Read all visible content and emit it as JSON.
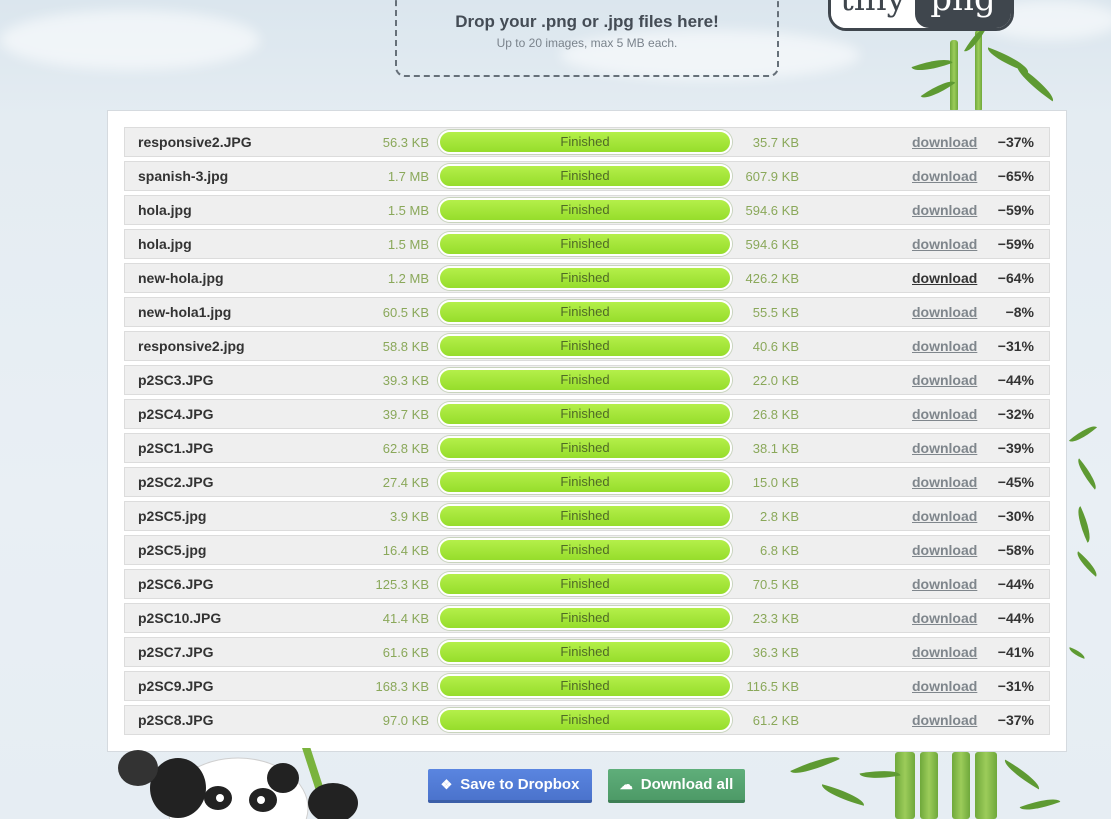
{
  "dropzone": {
    "title": "Drop your .png or .jpg files here!",
    "subtitle": "Up to 20 images, max 5 MB each."
  },
  "logo": {
    "left": "tiny",
    "right": "png"
  },
  "rows": [
    {
      "name": "responsive2.JPG",
      "size": "56.3 KB",
      "status": "Finished",
      "new_size": "35.7 KB",
      "link": "download",
      "saving": "−37%"
    },
    {
      "name": "spanish-3.jpg",
      "size": "1.7 MB",
      "status": "Finished",
      "new_size": "607.9 KB",
      "link": "download",
      "saving": "−65%"
    },
    {
      "name": "hola.jpg",
      "size": "1.5 MB",
      "status": "Finished",
      "new_size": "594.6 KB",
      "link": "download",
      "saving": "−59%"
    },
    {
      "name": "hola.jpg",
      "size": "1.5 MB",
      "status": "Finished",
      "new_size": "594.6 KB",
      "link": "download",
      "saving": "−59%"
    },
    {
      "name": "new-hola.jpg",
      "size": "1.2 MB",
      "status": "Finished",
      "new_size": "426.2 KB",
      "link": "download",
      "saving": "−64%"
    },
    {
      "name": "new-hola1.jpg",
      "size": "60.5 KB",
      "status": "Finished",
      "new_size": "55.5 KB",
      "link": "download",
      "saving": "−8%"
    },
    {
      "name": "responsive2.jpg",
      "size": "58.8 KB",
      "status": "Finished",
      "new_size": "40.6 KB",
      "link": "download",
      "saving": "−31%"
    },
    {
      "name": "p2SC3.JPG",
      "size": "39.3 KB",
      "status": "Finished",
      "new_size": "22.0 KB",
      "link": "download",
      "saving": "−44%"
    },
    {
      "name": "p2SC4.JPG",
      "size": "39.7 KB",
      "status": "Finished",
      "new_size": "26.8 KB",
      "link": "download",
      "saving": "−32%"
    },
    {
      "name": "p2SC1.JPG",
      "size": "62.8 KB",
      "status": "Finished",
      "new_size": "38.1 KB",
      "link": "download",
      "saving": "−39%"
    },
    {
      "name": "p2SC2.JPG",
      "size": "27.4 KB",
      "status": "Finished",
      "new_size": "15.0 KB",
      "link": "download",
      "saving": "−45%"
    },
    {
      "name": "p2SC5.jpg",
      "size": "3.9 KB",
      "status": "Finished",
      "new_size": "2.8 KB",
      "link": "download",
      "saving": "−30%"
    },
    {
      "name": "p2SC5.jpg",
      "size": "16.4 KB",
      "status": "Finished",
      "new_size": "6.8 KB",
      "link": "download",
      "saving": "−58%"
    },
    {
      "name": "p2SC6.JPG",
      "size": "125.3 KB",
      "status": "Finished",
      "new_size": "70.5 KB",
      "link": "download",
      "saving": "−44%"
    },
    {
      "name": "p2SC10.JPG",
      "size": "41.4 KB",
      "status": "Finished",
      "new_size": "23.3 KB",
      "link": "download",
      "saving": "−44%"
    },
    {
      "name": "p2SC7.JPG",
      "size": "61.6 KB",
      "status": "Finished",
      "new_size": "36.3 KB",
      "link": "download",
      "saving": "−41%"
    },
    {
      "name": "p2SC9.JPG",
      "size": "168.3 KB",
      "status": "Finished",
      "new_size": "116.5 KB",
      "link": "download",
      "saving": "−31%"
    },
    {
      "name": "p2SC8.JPG",
      "size": "97.0 KB",
      "status": "Finished",
      "new_size": "61.2 KB",
      "link": "download",
      "saving": "−37%"
    }
  ],
  "hovered_row_index": 4,
  "buttons": {
    "dropbox": {
      "label": "Save to Dropbox",
      "icon": "dropbox-icon"
    },
    "download_all": {
      "label": "Download all",
      "icon": "cloud-download-icon"
    }
  },
  "colors": {
    "progress": "#a8e63c",
    "dropbox_button": "#5079d6",
    "download_button": "#56a470",
    "size_text": "#8aa85a"
  }
}
